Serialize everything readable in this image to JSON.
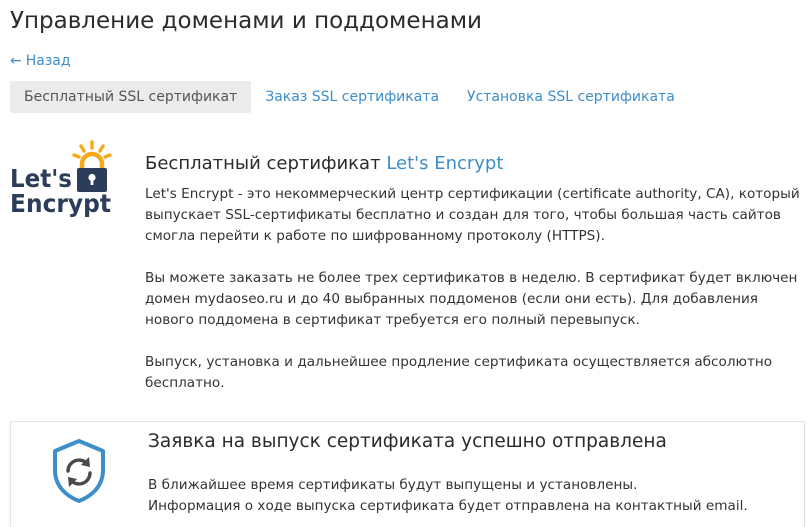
{
  "page": {
    "title": "Управление доменами и поддоменами"
  },
  "nav": {
    "back_arrow": "←",
    "back_label": "Назад"
  },
  "tabs": [
    {
      "label": "Бесплатный SSL сертификат",
      "active": true
    },
    {
      "label": "Заказ SSL сертификата",
      "active": false
    },
    {
      "label": "Установка SSL сертификата",
      "active": false
    }
  ],
  "logo": {
    "line1": "Let's",
    "line2": "Encrypt",
    "icon": "padlock-sun-icon"
  },
  "info": {
    "title_prefix": "Бесплатный сертификат",
    "title_link": "Let's Encrypt",
    "paragraphs": [
      "Let's Encrypt - это некоммерческий центр сертификации (certificate authority, CA), который выпускает SSL-сертификаты бесплатно и создан для того, чтобы большая часть сайтов смогла перейти к работе по шифрованному протоколу (HTTPS).",
      "Вы можете заказать не более трех сертификатов в неделю. В сертификат будет включен домен mydaoseo.ru и до 40 выбранных поддоменов (если они есть). Для добавления нового поддомена в сертификат требуется его полный перевыпуск.",
      "Выпуск, установка и дальнейшее продление сертификата осуществляется абсолютно бесплатно."
    ]
  },
  "notice": {
    "icon": "shield-refresh-icon",
    "title": "Заявка на выпуск сертификата успешно отправлена",
    "lines": [
      "В ближайшее время сертификаты будут выпущены и установлены.",
      "Информация о ходе выпуска сертификата будет отправлена на контактный email."
    ]
  },
  "colors": {
    "link": "#3d8ec9",
    "tab_active_bg": "#ebebeb",
    "logo_navy": "#2c3c5b",
    "logo_orange": "#f7a81b",
    "shield_blue": "#3d8ec9"
  }
}
